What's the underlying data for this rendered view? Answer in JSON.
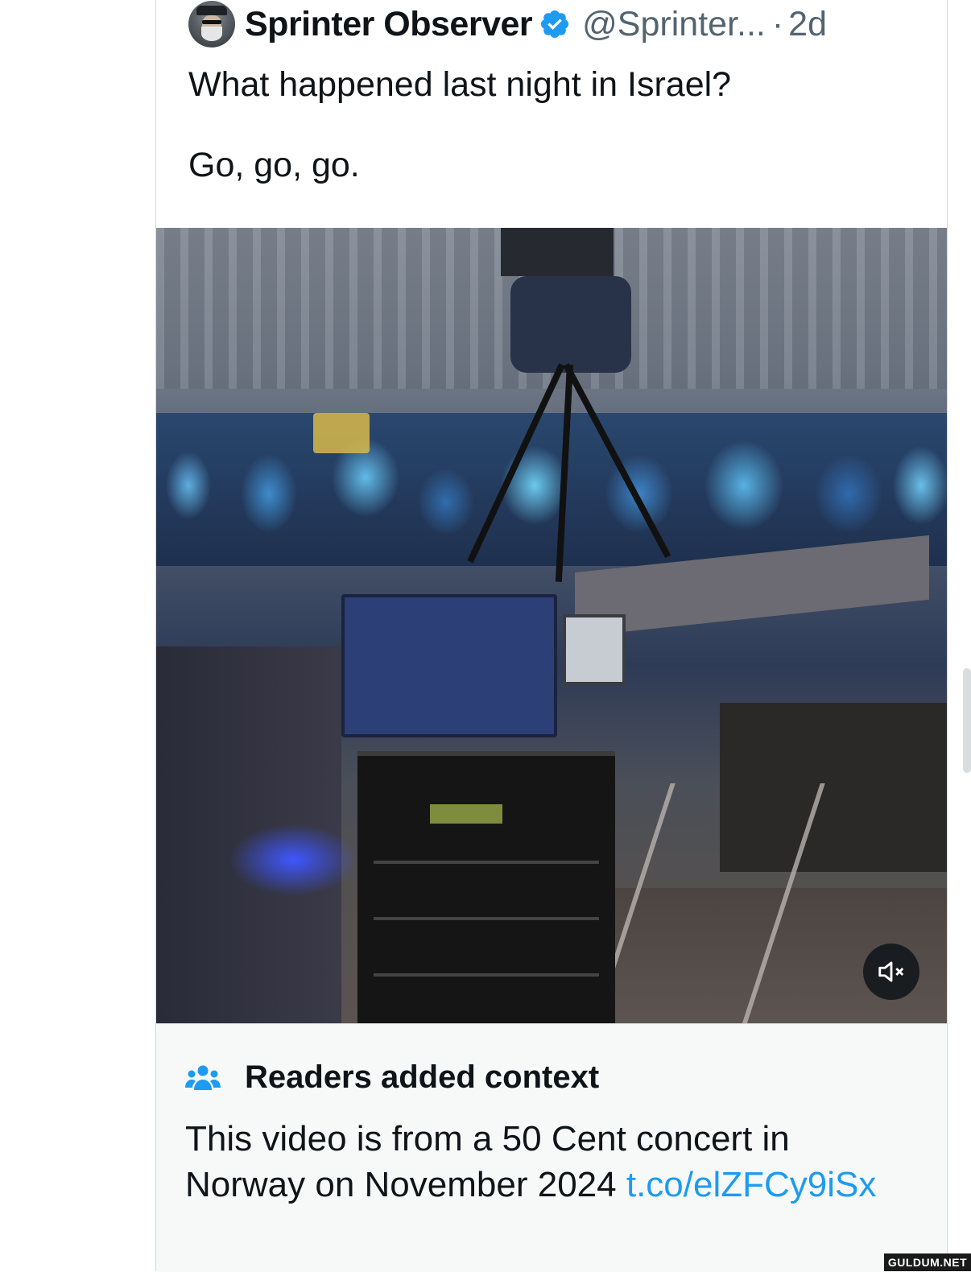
{
  "tweet": {
    "author_name": "Sprinter Observer",
    "handle": "@Sprinter...",
    "separator": "·",
    "time": "2d",
    "text": "What happened last night in Israel?\n\nGo, go, go.",
    "verified_icon": "verified-badge-icon",
    "verified_color": "#1d9bf0"
  },
  "media": {
    "mute_icon": "volume-muted-icon"
  },
  "community_note": {
    "icon": "people-group-icon",
    "title": "Readers added context",
    "body_text": "This video is from a 50 Cent concert in Norway on November 2024 ",
    "link_text": "t.co/​elZFCy9iSx",
    "link_color": "#1d9bf0"
  },
  "watermark": {
    "text": "GULDUM.NET"
  }
}
